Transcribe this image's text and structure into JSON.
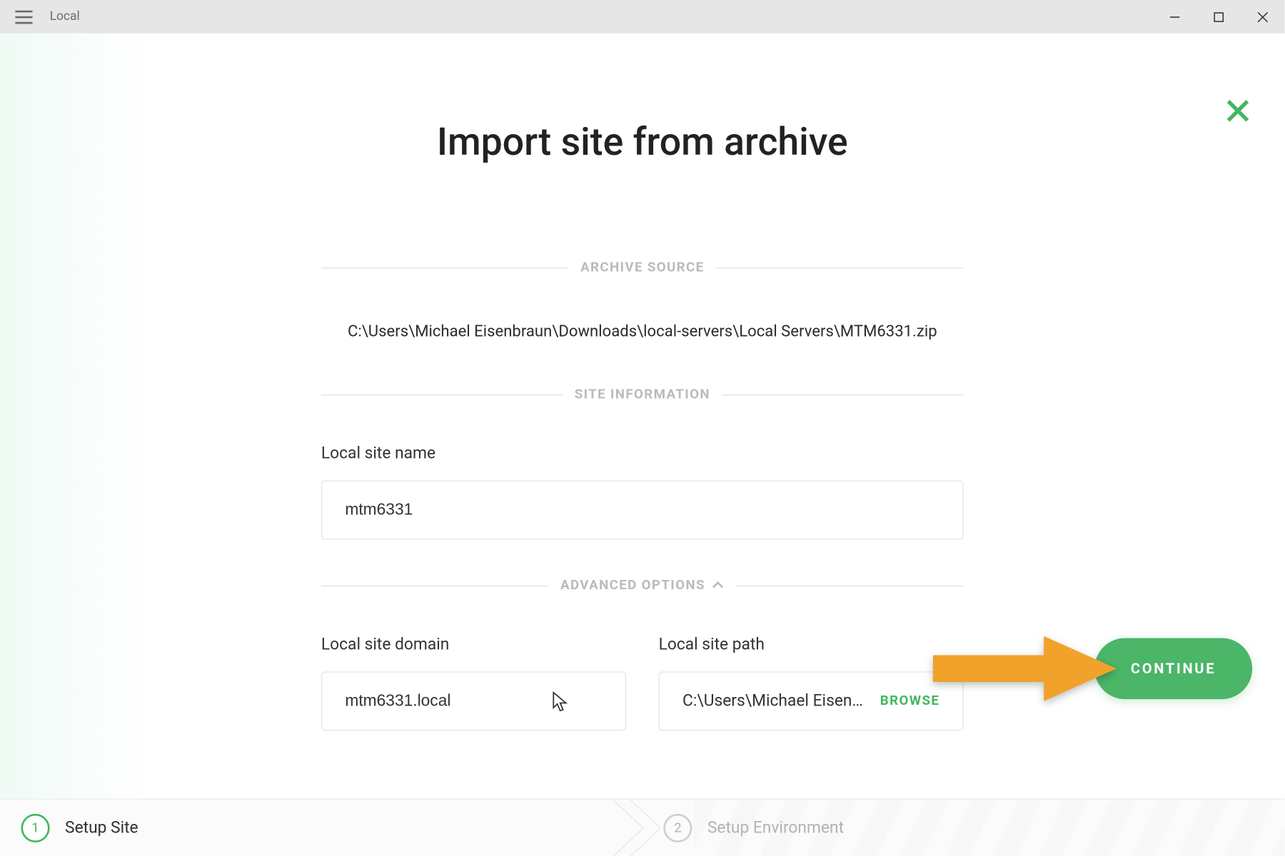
{
  "titlebar": {
    "app_name": "Local"
  },
  "page": {
    "title": "Import site from archive"
  },
  "sections": {
    "archive_label": "ARCHIVE SOURCE",
    "archive_path": "C:\\Users\\Michael Eisenbraun\\Downloads\\local-servers\\Local Servers\\MTM6331.zip",
    "site_info_label": "SITE INFORMATION",
    "site_name_label": "Local site name",
    "site_name_value": "mtm6331",
    "advanced_label": "ADVANCED OPTIONS",
    "domain_label": "Local site domain",
    "domain_value": "mtm6331.local",
    "path_label": "Local site path",
    "path_value": "C:\\Users\\Michael Eisen…",
    "browse_label": "BROWSE"
  },
  "buttons": {
    "continue_label": "CONTINUE"
  },
  "steps": {
    "step1_num": "1",
    "step1_label": "Setup Site",
    "step2_num": "2",
    "step2_label": "Setup Environment"
  }
}
